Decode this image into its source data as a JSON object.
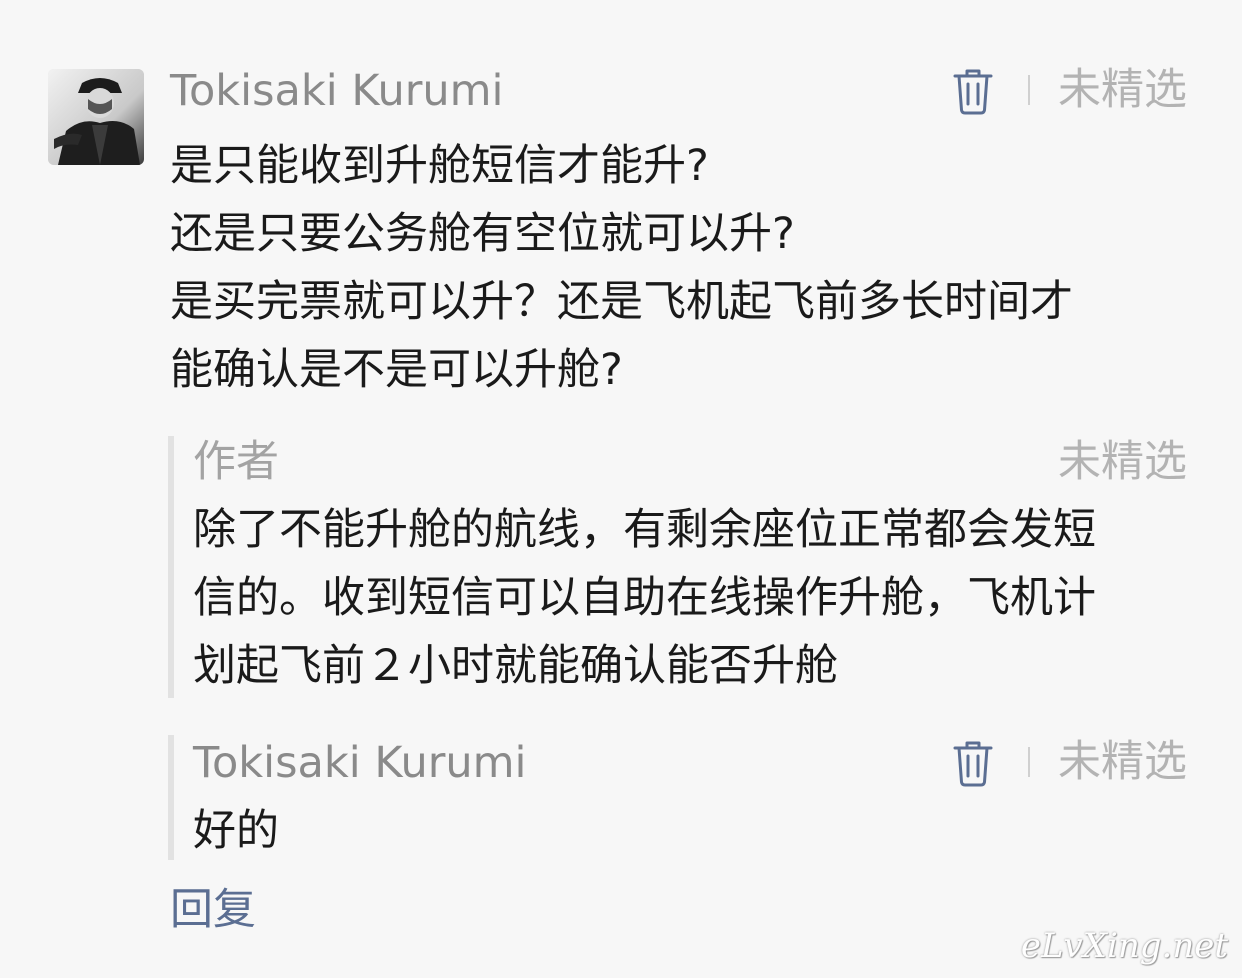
{
  "comment": {
    "author": "Tokisaki Kurumi",
    "unselected_label": "未精选",
    "lines": [
      "是只能收到升舱短信才能升?",
      "还是只要公务舱有空位就可以升?",
      "是买完票就可以升？还是飞机起飞前多长时间才",
      "能确认是不是可以升舱?"
    ]
  },
  "replies": [
    {
      "author": "作者",
      "unselected_label": "未精选",
      "lines": [
        "除了不能升舱的航线，有剩余座位正常都会发短",
        "信的。收到短信可以自助在线操作升舱，飞机计",
        "划起飞前２小时就能确认能否升舱"
      ]
    },
    {
      "author": "Tokisaki Kurumi",
      "unselected_label": "未精选",
      "lines": [
        "好的"
      ]
    }
  ],
  "reply_link": "回复",
  "watermark": "eLvXing.net",
  "icons": {
    "delete": "trash-icon"
  },
  "colors": {
    "background": "#f7f7f7",
    "name": "#8a8a8a",
    "muted": "#b3b3b3",
    "link": "#5b6e92",
    "quote_bar": "#e2e2e2",
    "icon": "#5b6e92"
  }
}
